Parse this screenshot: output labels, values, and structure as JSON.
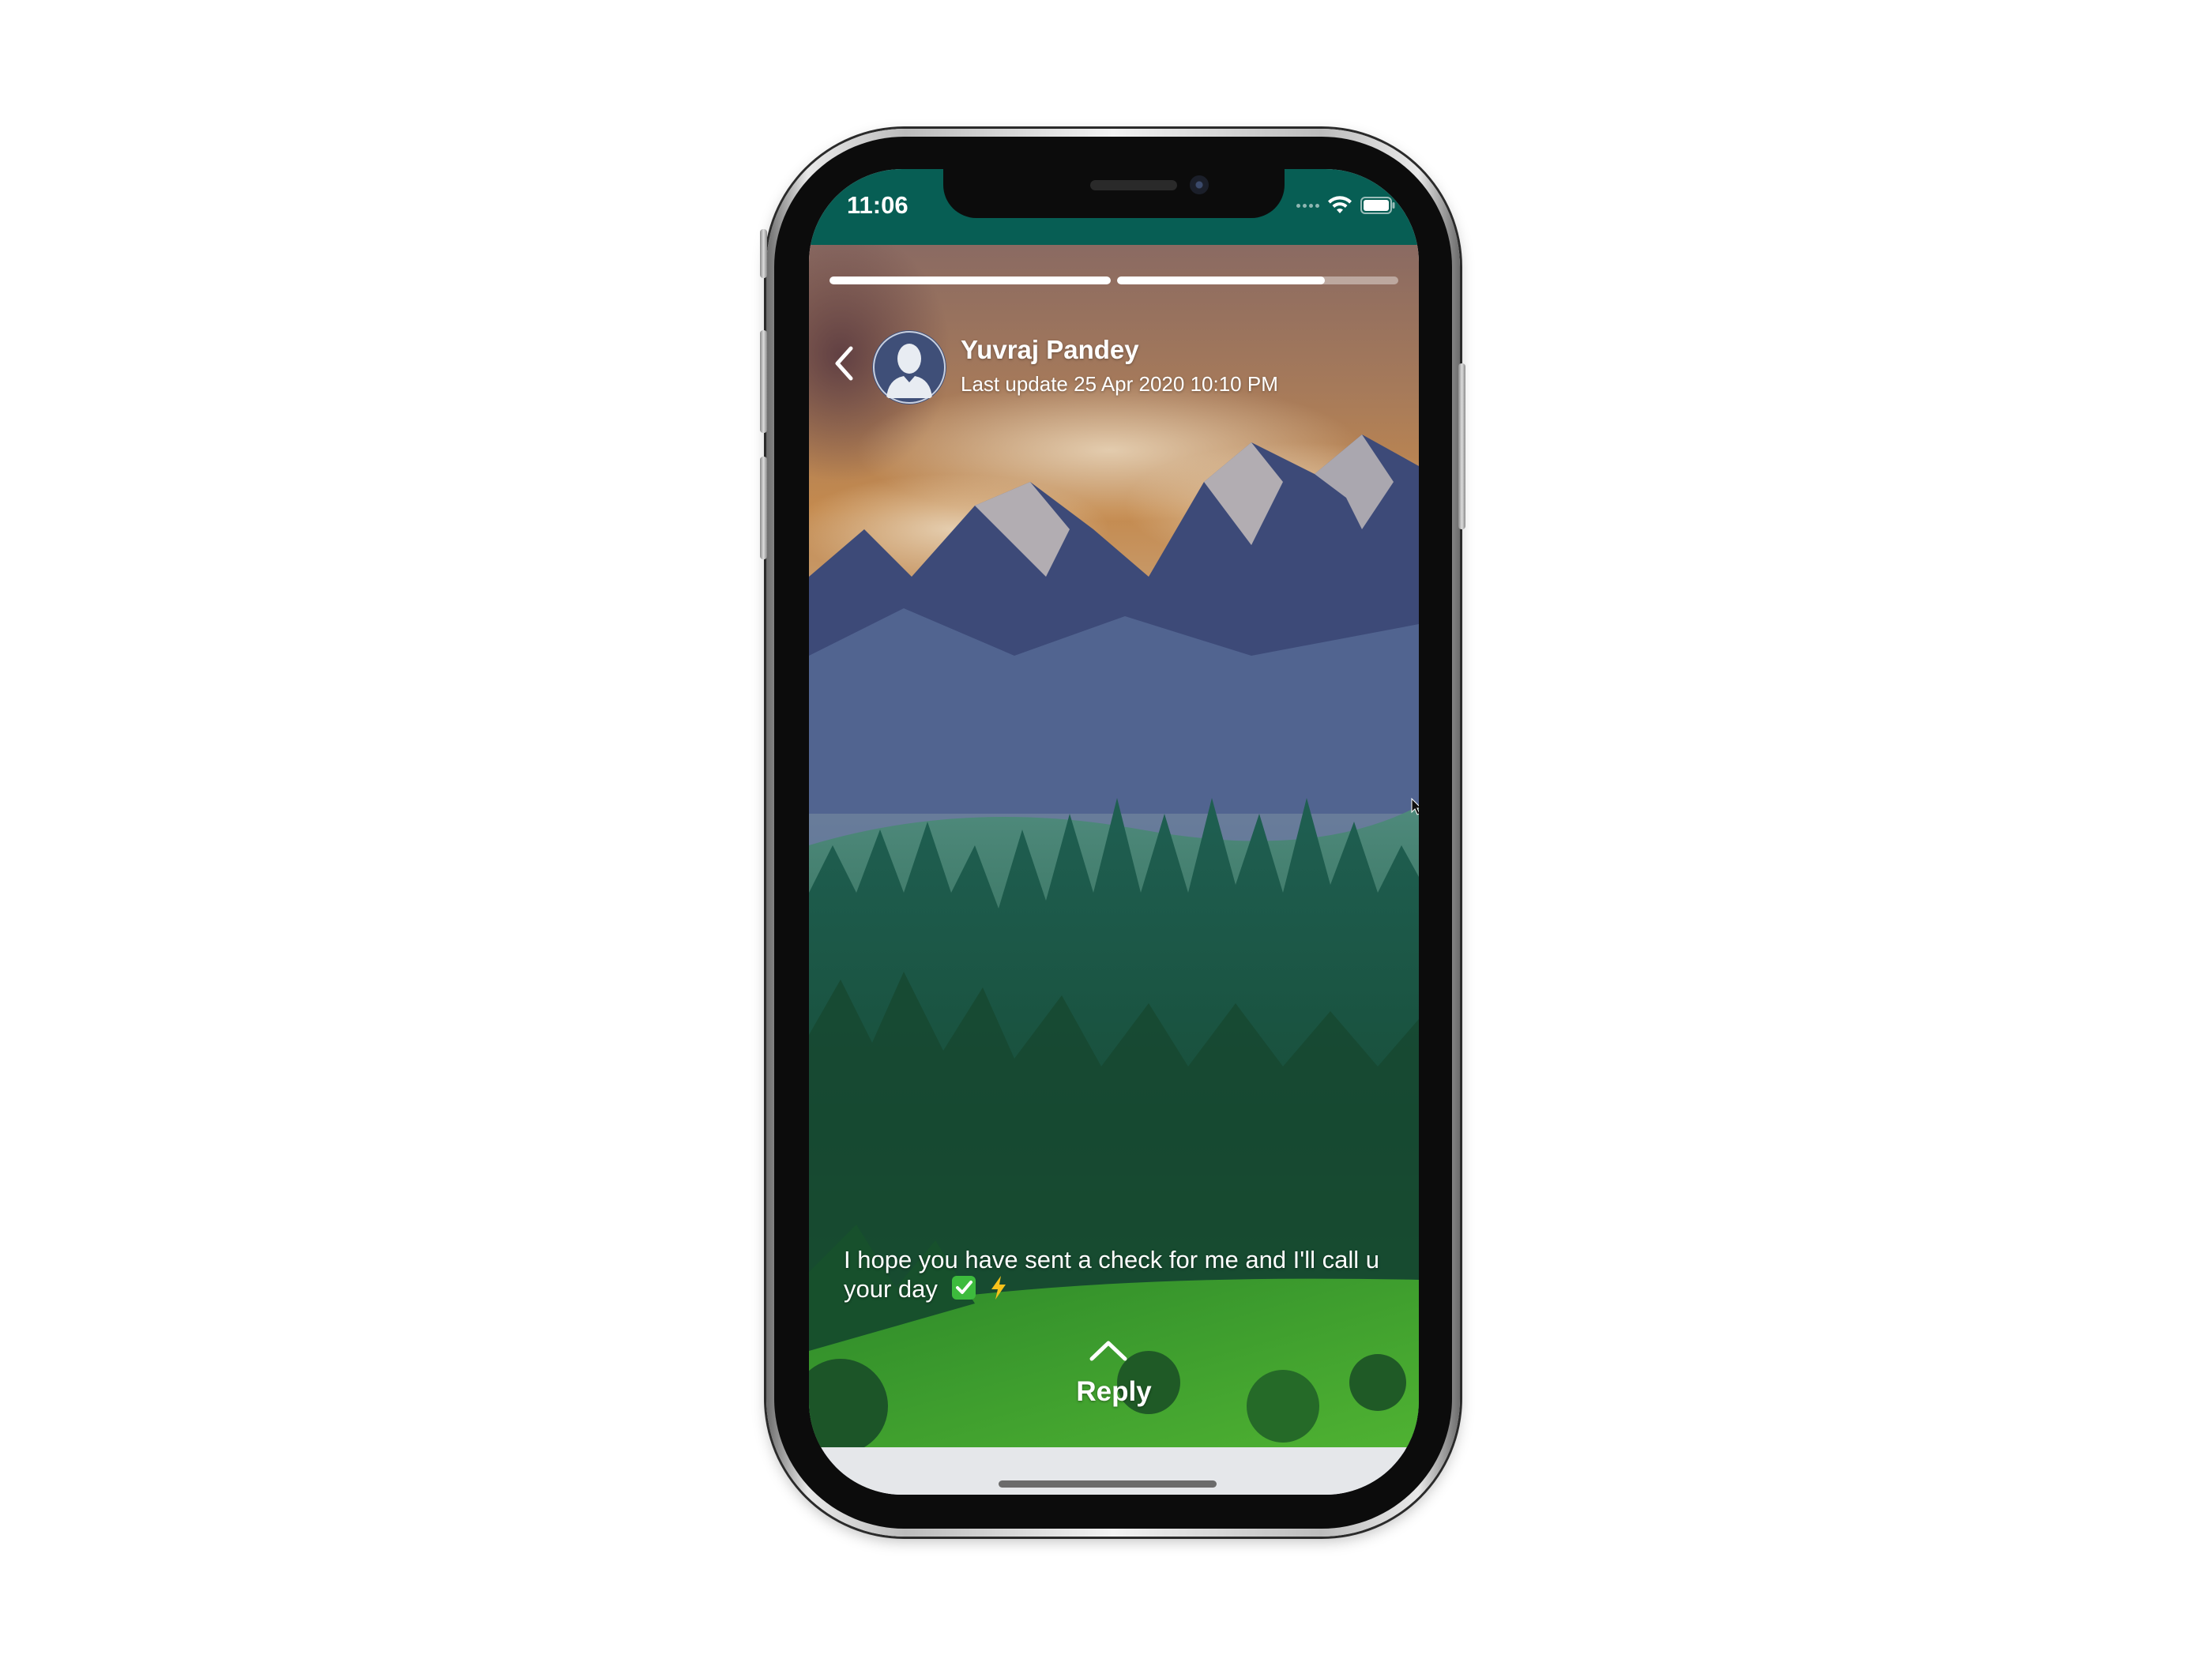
{
  "status_bar": {
    "time": "11:06",
    "icons": [
      "signal-dots-icon",
      "wifi-icon",
      "battery-icon"
    ],
    "background_color": "#075e54"
  },
  "story": {
    "progress": [
      1.0,
      0.74
    ],
    "user_name": "Yuvraj Pandey",
    "last_update": "Last update 25 Apr 2020 10:10 PM",
    "caption": "I hope you have sent a check for me and I'll call u your day",
    "caption_emojis": [
      "check-mark-button-icon",
      "high-voltage-icon"
    ],
    "reply_label": "Reply",
    "background_description_icon": "mountain-forest-landscape-image"
  }
}
